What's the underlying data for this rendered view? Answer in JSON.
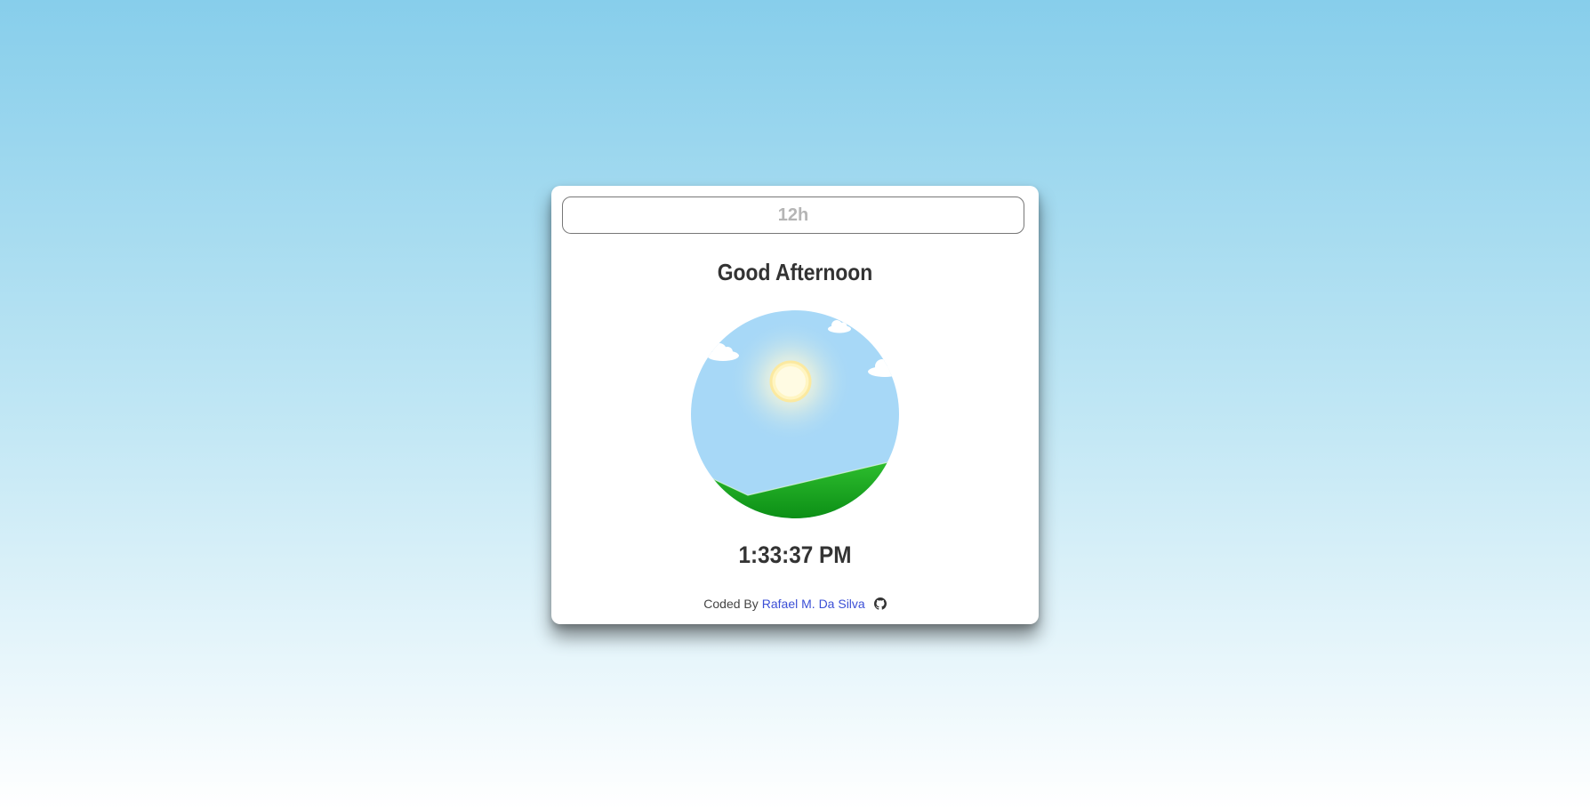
{
  "toggle": {
    "label": "12h"
  },
  "greeting": "Good Afternoon",
  "scene": {
    "sky_color": "#a7d8f7",
    "sun_color": "#fff5c2",
    "grass_color": "#1faa1f",
    "icons": [
      "sun-icon",
      "cloud-icon",
      "hill-icon"
    ]
  },
  "clock": {
    "time": "1:33:37 PM"
  },
  "footer": {
    "prefix": "Coded By",
    "author": "Rafael M. Da Silva",
    "link_color": "#3b4fd6",
    "icon": "github-icon"
  }
}
